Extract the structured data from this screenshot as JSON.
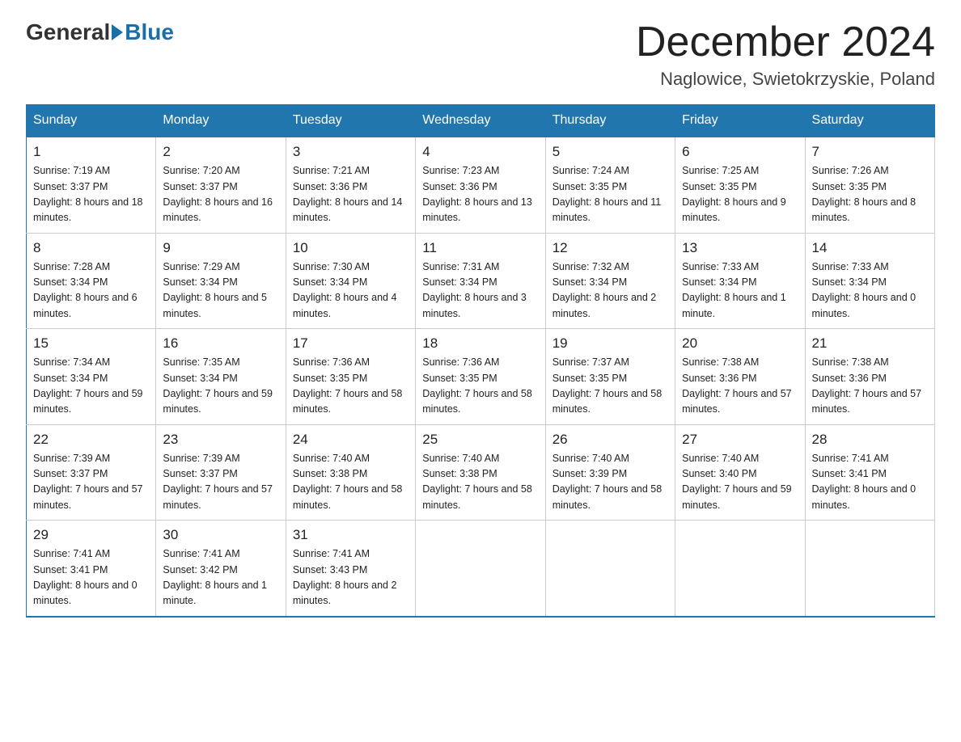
{
  "logo": {
    "general": "General",
    "blue": "Blue"
  },
  "header": {
    "month": "December 2024",
    "location": "Naglowice, Swietokrzyskie, Poland"
  },
  "days_of_week": [
    "Sunday",
    "Monday",
    "Tuesday",
    "Wednesday",
    "Thursday",
    "Friday",
    "Saturday"
  ],
  "weeks": [
    [
      {
        "day": "1",
        "sunrise": "7:19 AM",
        "sunset": "3:37 PM",
        "daylight": "8 hours and 18 minutes."
      },
      {
        "day": "2",
        "sunrise": "7:20 AM",
        "sunset": "3:37 PM",
        "daylight": "8 hours and 16 minutes."
      },
      {
        "day": "3",
        "sunrise": "7:21 AM",
        "sunset": "3:36 PM",
        "daylight": "8 hours and 14 minutes."
      },
      {
        "day": "4",
        "sunrise": "7:23 AM",
        "sunset": "3:36 PM",
        "daylight": "8 hours and 13 minutes."
      },
      {
        "day": "5",
        "sunrise": "7:24 AM",
        "sunset": "3:35 PM",
        "daylight": "8 hours and 11 minutes."
      },
      {
        "day": "6",
        "sunrise": "7:25 AM",
        "sunset": "3:35 PM",
        "daylight": "8 hours and 9 minutes."
      },
      {
        "day": "7",
        "sunrise": "7:26 AM",
        "sunset": "3:35 PM",
        "daylight": "8 hours and 8 minutes."
      }
    ],
    [
      {
        "day": "8",
        "sunrise": "7:28 AM",
        "sunset": "3:34 PM",
        "daylight": "8 hours and 6 minutes."
      },
      {
        "day": "9",
        "sunrise": "7:29 AM",
        "sunset": "3:34 PM",
        "daylight": "8 hours and 5 minutes."
      },
      {
        "day": "10",
        "sunrise": "7:30 AM",
        "sunset": "3:34 PM",
        "daylight": "8 hours and 4 minutes."
      },
      {
        "day": "11",
        "sunrise": "7:31 AM",
        "sunset": "3:34 PM",
        "daylight": "8 hours and 3 minutes."
      },
      {
        "day": "12",
        "sunrise": "7:32 AM",
        "sunset": "3:34 PM",
        "daylight": "8 hours and 2 minutes."
      },
      {
        "day": "13",
        "sunrise": "7:33 AM",
        "sunset": "3:34 PM",
        "daylight": "8 hours and 1 minute."
      },
      {
        "day": "14",
        "sunrise": "7:33 AM",
        "sunset": "3:34 PM",
        "daylight": "8 hours and 0 minutes."
      }
    ],
    [
      {
        "day": "15",
        "sunrise": "7:34 AM",
        "sunset": "3:34 PM",
        "daylight": "7 hours and 59 minutes."
      },
      {
        "day": "16",
        "sunrise": "7:35 AM",
        "sunset": "3:34 PM",
        "daylight": "7 hours and 59 minutes."
      },
      {
        "day": "17",
        "sunrise": "7:36 AM",
        "sunset": "3:35 PM",
        "daylight": "7 hours and 58 minutes."
      },
      {
        "day": "18",
        "sunrise": "7:36 AM",
        "sunset": "3:35 PM",
        "daylight": "7 hours and 58 minutes."
      },
      {
        "day": "19",
        "sunrise": "7:37 AM",
        "sunset": "3:35 PM",
        "daylight": "7 hours and 58 minutes."
      },
      {
        "day": "20",
        "sunrise": "7:38 AM",
        "sunset": "3:36 PM",
        "daylight": "7 hours and 57 minutes."
      },
      {
        "day": "21",
        "sunrise": "7:38 AM",
        "sunset": "3:36 PM",
        "daylight": "7 hours and 57 minutes."
      }
    ],
    [
      {
        "day": "22",
        "sunrise": "7:39 AM",
        "sunset": "3:37 PM",
        "daylight": "7 hours and 57 minutes."
      },
      {
        "day": "23",
        "sunrise": "7:39 AM",
        "sunset": "3:37 PM",
        "daylight": "7 hours and 57 minutes."
      },
      {
        "day": "24",
        "sunrise": "7:40 AM",
        "sunset": "3:38 PM",
        "daylight": "7 hours and 58 minutes."
      },
      {
        "day": "25",
        "sunrise": "7:40 AM",
        "sunset": "3:38 PM",
        "daylight": "7 hours and 58 minutes."
      },
      {
        "day": "26",
        "sunrise": "7:40 AM",
        "sunset": "3:39 PM",
        "daylight": "7 hours and 58 minutes."
      },
      {
        "day": "27",
        "sunrise": "7:40 AM",
        "sunset": "3:40 PM",
        "daylight": "7 hours and 59 minutes."
      },
      {
        "day": "28",
        "sunrise": "7:41 AM",
        "sunset": "3:41 PM",
        "daylight": "8 hours and 0 minutes."
      }
    ],
    [
      {
        "day": "29",
        "sunrise": "7:41 AM",
        "sunset": "3:41 PM",
        "daylight": "8 hours and 0 minutes."
      },
      {
        "day": "30",
        "sunrise": "7:41 AM",
        "sunset": "3:42 PM",
        "daylight": "8 hours and 1 minute."
      },
      {
        "day": "31",
        "sunrise": "7:41 AM",
        "sunset": "3:43 PM",
        "daylight": "8 hours and 2 minutes."
      },
      null,
      null,
      null,
      null
    ]
  ]
}
